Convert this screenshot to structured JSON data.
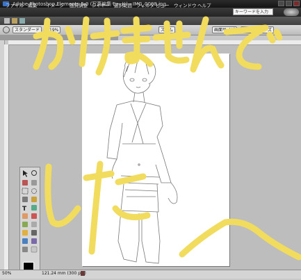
{
  "window": {
    "title": "Adobe Photoshop Elements 5.0 (写真編集モード) - IMG_0008.jpg",
    "accent_color": "#3a73c8"
  },
  "menubar": {
    "items": [
      "ファイル",
      "編集",
      "イメージ",
      "画質調整",
      "レイヤー",
      "選択範囲",
      "フィルタ",
      "ビュー",
      "ウィンドウ",
      "ヘルプ"
    ],
    "search_placeholder": "キーワードを入力"
  },
  "options_bar": {
    "left_button": "スタンダード",
    "zoom_button": "ズーム",
    "zoom_value": "19%",
    "right_buttons": [
      "画面サイズ",
      "プリントサイズ"
    ]
  },
  "status": {
    "zoom": "50%",
    "doc_info": "121.24 mm (300 ppi)"
  },
  "overlay": {
    "handwriting_color": "#f2dc5d",
    "handwriting_top": "かけませんでした",
    "handwriting_bottom": "した〜"
  }
}
